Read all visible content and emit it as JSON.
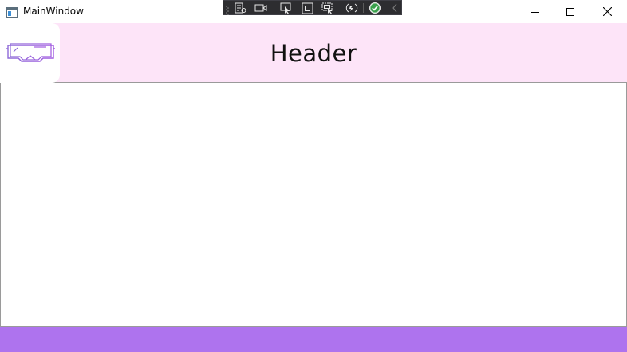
{
  "window": {
    "title": "MainWindow",
    "app_icon": "window-app-icon",
    "controls": [
      "minimize-icon",
      "maximize-icon",
      "close-icon"
    ]
  },
  "debug_toolbar": {
    "icons": [
      "live-visual-tree-icon",
      "record-icon",
      "select-element-icon",
      "display-layout-adorners-icon",
      "track-focus-icon",
      "hot-reload-icon",
      "binding-ok-icon",
      "collapse-toolbar-icon"
    ]
  },
  "header": {
    "title": "Header",
    "logo": "vr-headset-icon",
    "background": "#fde4f8"
  },
  "footer": {
    "background": "#ae73ee"
  }
}
